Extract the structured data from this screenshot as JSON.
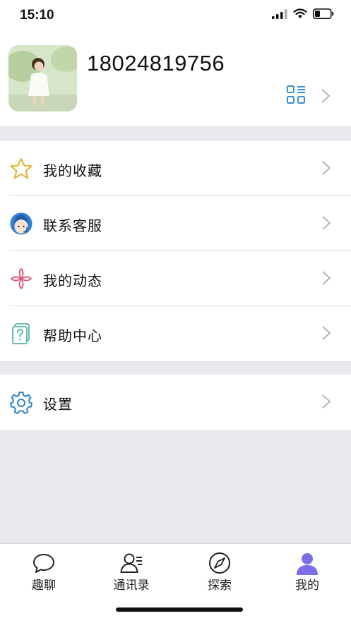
{
  "status_bar": {
    "time": "15:10"
  },
  "profile": {
    "phone": "18024819756",
    "qr_icon": "qr-code-icon",
    "avatar_icon": "avatar-photo"
  },
  "menu_group_1": [
    {
      "label": "我的收藏",
      "icon": "star-icon",
      "color": "#e5b53a"
    },
    {
      "label": "联系客服",
      "icon": "customer-service-icon",
      "color": "#2f7fd6"
    },
    {
      "label": "我的动态",
      "icon": "pinwheel-icon",
      "color": "#d9547a"
    },
    {
      "label": "帮助中心",
      "icon": "help-icon",
      "color": "#56b3a8"
    }
  ],
  "menu_group_2": [
    {
      "label": "设置",
      "icon": "settings-gear-icon",
      "color": "#2f86c8"
    }
  ],
  "tab_bar": {
    "tabs": [
      {
        "label": "趣聊",
        "icon": "chat-bubble-icon"
      },
      {
        "label": "通讯录",
        "icon": "contacts-icon"
      },
      {
        "label": "探索",
        "icon": "compass-icon"
      },
      {
        "label": "我的",
        "icon": "profile-icon",
        "active": true
      }
    ],
    "active_color": "#7b6ee6"
  }
}
